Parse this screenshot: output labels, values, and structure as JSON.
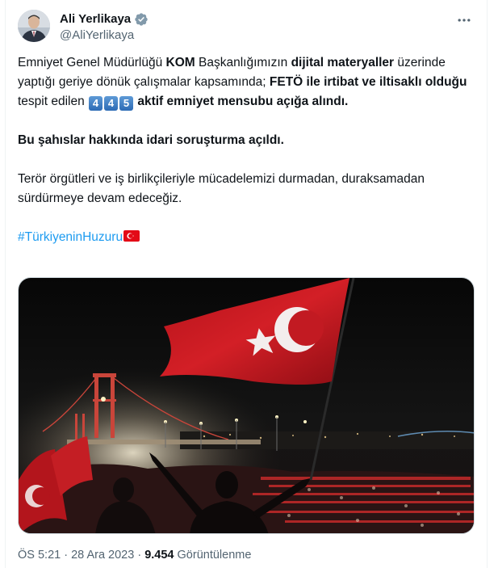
{
  "author": {
    "name": "Ali Yerlikaya",
    "handle": "@AliYerlikaya"
  },
  "icons": {
    "verified": "verified-badge-icon",
    "more": "more-horizontal-icon",
    "flag": "turkey-flag-emoji"
  },
  "tweet": {
    "p1": {
      "t1": "Emniyet Genel Müdürlüğü ",
      "b1": "KOM",
      "t2": " Başkanlığımızın ",
      "b2": "dijital materyaller",
      "t3": " üzerinde yaptığı geriye dönük çalışmalar kapsamında; ",
      "b3": "FETÖ ile irtibat ve iltisaklı olduğu",
      "t4": " tespit edilen ",
      "digits": [
        "4",
        "4",
        "5"
      ],
      "b4": " aktif emniyet mensubu açığa alındı."
    },
    "p2": "Bu şahıslar hakkında idari soruşturma açıldı.",
    "p3": "Terör örgütleri ve iş birlikçileriyle mücadelemizi durmadan, duraksamadan sürdürmeye devam edeceğiz.",
    "hashtag": "#TürkiyeninHuzuru"
  },
  "meta": {
    "time": "ÖS 5:21",
    "sep": " · ",
    "date": "28 Ara 2023",
    "views": "9.454",
    "views_label": " Görüntülenme"
  },
  "colors": {
    "text": "#0f1419",
    "secondary": "#536471",
    "link": "#1d9bf0",
    "flag_red": "#e30a17"
  }
}
